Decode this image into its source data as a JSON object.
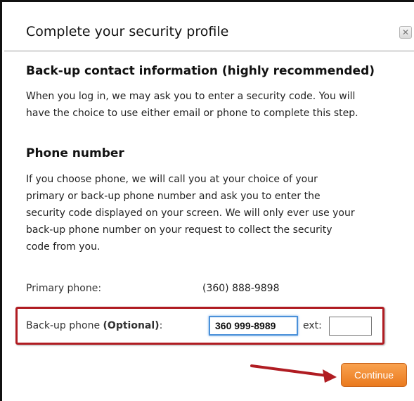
{
  "dialog": {
    "title": "Complete your security profile",
    "close_icon": "close-icon"
  },
  "backup_section": {
    "heading": "Back-up contact information (highly recommended)",
    "text_lines": [
      "When you log in, we may ask you to enter a security code. You will",
      "have the choice to use either email or phone to complete this step."
    ]
  },
  "phone_section": {
    "heading": "Phone number",
    "text_lines": [
      "If you choose phone, we will call you at your choice of your",
      "primary or back-up phone number and ask you to enter the",
      "security code displayed on your screen. We will only ever use your",
      "back-up phone number on your request to collect the security",
      "code from you."
    ]
  },
  "primary_phone": {
    "label": "Primary phone:",
    "value": "(360) 888-9898"
  },
  "backup_phone": {
    "label": "Back-up phone ",
    "optional": "(Optional)",
    "colon": ":",
    "value": "360 999-8989",
    "ext_label": "ext:",
    "ext_value": ""
  },
  "actions": {
    "continue_label": "Continue"
  },
  "colors": {
    "highlight": "#b01c22",
    "button": "#ea7a1e",
    "input_focus": "#4a90d9"
  }
}
